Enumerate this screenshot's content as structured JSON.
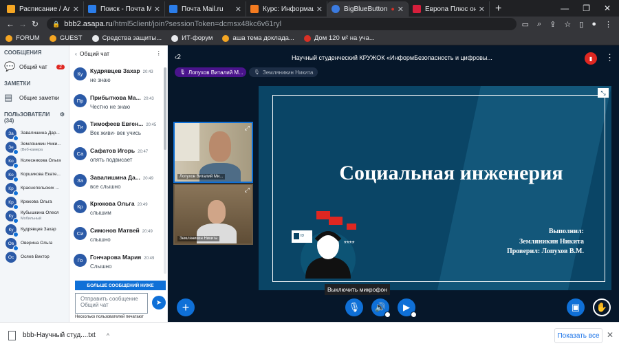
{
  "browser": {
    "tabs": [
      {
        "label": "Расписание / Алтайск",
        "color": "#f5a623",
        "active": false
      },
      {
        "label": "Поиск - Почта Mail.ru",
        "color": "#2b7de9",
        "active": false
      },
      {
        "label": "Почта Mail.ru",
        "color": "#2b7de9",
        "active": false
      },
      {
        "label": "Курс: Информацион",
        "color": "#f47b20",
        "active": false
      },
      {
        "label": "BigBlueButton - Н",
        "color": "#3b7be0",
        "active": true
      },
      {
        "label": "Европа Плюс онлай",
        "color": "#d61f3c",
        "active": false
      }
    ],
    "url_host": "bbb2.asapa.ru",
    "url_path": "/html5client/join?sessionToken=dcmsx48kc6v61ryl",
    "bookmarks": [
      {
        "label": "FORUM",
        "color": "#f5a623"
      },
      {
        "label": "GUEST",
        "color": "#f5a623"
      },
      {
        "label": "Средства защиты...",
        "color": "#e8eaed"
      },
      {
        "label": "ИТ-форум",
        "color": "#e8eaed"
      },
      {
        "label": "ашa тема доклада...",
        "color": "#f5a623"
      },
      {
        "label": "Дом 120 м² на уча...",
        "color": "#d93025"
      }
    ]
  },
  "sidebar": {
    "messages_heading": "СООБЩЕНИЯ",
    "public_chat_label": "Общий чат",
    "public_chat_badge": "2",
    "notes_heading": "ЗАМЕТКИ",
    "shared_notes_label": "Общие заметки",
    "users_heading": "ПОЛЬЗОВАТЕЛИ (34)",
    "users": [
      {
        "initials": "За",
        "name": "Завалишина Дар...",
        "sub": ""
      },
      {
        "initials": "Зе",
        "name": "Земляникин Ники...",
        "sub": "(Веб-камера"
      },
      {
        "initials": "Ко",
        "name": "Колесникова Ольга",
        "sub": ""
      },
      {
        "initials": "Ко",
        "name": "Коршикова Екате...",
        "sub": ""
      },
      {
        "initials": "Кр",
        "name": "Краснопольских ...",
        "sub": ""
      },
      {
        "initials": "Кр",
        "name": "Крюкова Ольга",
        "sub": ""
      },
      {
        "initials": "Ку",
        "name": "Кубышкина Олеся",
        "sub": "Мобильный"
      },
      {
        "initials": "Ку",
        "name": "Кудрявцев Захар",
        "sub": ""
      },
      {
        "initials": "Ов",
        "name": "Оверина Ольга",
        "sub": ""
      },
      {
        "initials": "Ос",
        "name": "Осяев Виктор",
        "sub": ""
      }
    ]
  },
  "chat": {
    "title": "Общий чат",
    "messages": [
      {
        "initials": "Ку",
        "name": "Кудрявцев Захар",
        "time": "20:43",
        "text": "не знаю"
      },
      {
        "initials": "Пр",
        "name": "Прибыткова Ма...",
        "time": "20:43",
        "text": "Честно не знаю"
      },
      {
        "initials": "Ти",
        "name": "Тимофеев Евген...",
        "time": "20:45",
        "text": "Век живи- век учись"
      },
      {
        "initials": "Са",
        "name": "Сафатов Игорь",
        "time": "20:47",
        "text": "опять подвисает"
      },
      {
        "initials": "За",
        "name": "Завалишина Да...",
        "time": "20:49",
        "text": "все слышно"
      },
      {
        "initials": "Кр",
        "name": "Крюкова Ольга",
        "time": "20:49",
        "text": "слышим"
      },
      {
        "initials": "Си",
        "name": "Симонов Матвей",
        "time": "20:49",
        "text": "слышно"
      },
      {
        "initials": "Го",
        "name": "Гончарова Мария",
        "time": "20:49",
        "text": "Слышно"
      }
    ],
    "more_messages": "БОЛЬШЕ СООБЩЕНИЙ НИЖЕ",
    "input_placeholder": "Отправить сообщение Общий чат",
    "typing_status": "Несколько пользователей печатают"
  },
  "meeting": {
    "back_count": "2",
    "title": "Научный студенческий КРУЖОК «ИнформБезопасность и цифровы...",
    "talking": [
      "Лопухов Виталий М...",
      "Земляникин Никита"
    ],
    "cams": [
      "Лопухов Виталий Ми...",
      "Земляникин Никита"
    ],
    "slide": {
      "title": "Социальная инженерия",
      "line1": "Выполнил:",
      "line2": "Земляникин Никита",
      "line3": "Проверил: Лопухов В.М.",
      "id_label": "ID",
      "password_mask": "****"
    },
    "tooltip": "Выключить микрофон"
  },
  "downloads": {
    "filename": "bbb-Научный студ....txt",
    "show_all": "Показать все"
  }
}
